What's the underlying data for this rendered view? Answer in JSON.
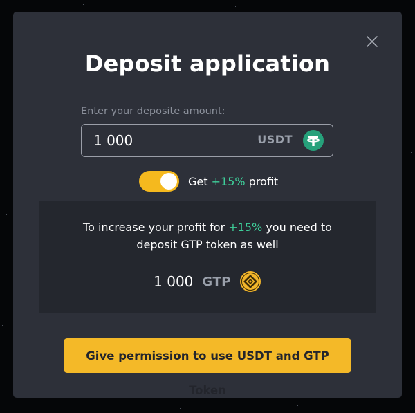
{
  "dialog": {
    "title": "Deposit application",
    "amount_label": "Enter your deposite amount:",
    "amount_value": "1 000",
    "amount_currency": "USDT",
    "toggle": {
      "on": true,
      "prefix": "Get",
      "bonus": "+15%",
      "suffix": "profit"
    },
    "info": {
      "line1_prefix": "To increase your profit for",
      "line1_bonus": "+15%",
      "line1_suffix": "you need to",
      "line2": "deposit GTP token as well",
      "gtp_amount": "1 000",
      "gtp_currency": "GTP"
    },
    "permission_button": "Give permission to use USDT and GTP Token"
  },
  "icons": {
    "close": "close-icon",
    "usdt": "usdt-tether-icon",
    "gtp": "gtp-token-icon"
  },
  "colors": {
    "accent_yellow": "#f4b928",
    "bonus_green": "#3ecf9a",
    "tether_green": "#26a17b",
    "modal_bg": "#2d3039",
    "panel_bg": "#24272e"
  }
}
